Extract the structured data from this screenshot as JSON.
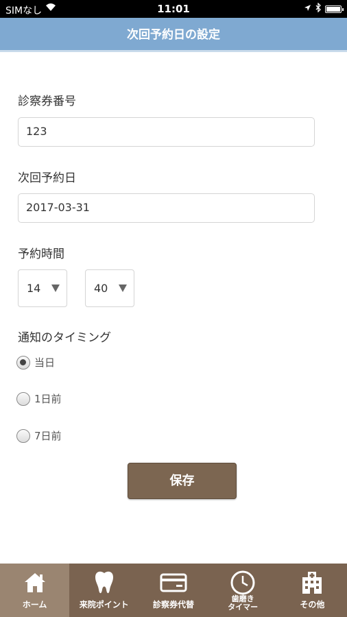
{
  "status_bar": {
    "carrier": "SIMなし",
    "time": "11:01"
  },
  "nav": {
    "title": "次回予約日の設定"
  },
  "form": {
    "card_number": {
      "label": "診察券番号",
      "value": "123"
    },
    "next_date": {
      "label": "次回予約日",
      "value": "2017-03-31"
    },
    "time": {
      "label": "予約時間",
      "hour": "14",
      "minute": "40"
    },
    "notify": {
      "label": "通知のタイミング",
      "options": [
        {
          "label": "当日",
          "checked": true
        },
        {
          "label": "1日前",
          "checked": false
        },
        {
          "label": "7日前",
          "checked": false
        }
      ]
    },
    "save_label": "保存"
  },
  "tabs": [
    {
      "label": "ホーム",
      "icon": "home-icon",
      "active": true
    },
    {
      "label": "来院ポイント",
      "icon": "tooth-icon",
      "active": false
    },
    {
      "label": "診察券代替",
      "icon": "card-icon",
      "active": false
    },
    {
      "label": "歯磨き\nタイマー",
      "icon": "clock-icon",
      "active": false
    },
    {
      "label": "その他",
      "icon": "hospital-icon",
      "active": false
    }
  ],
  "colors": {
    "nav_bar": "#7fa9d1",
    "save_button": "#7c6651",
    "tab_bar": "#7a6350",
    "tab_active": "#9a8571"
  }
}
